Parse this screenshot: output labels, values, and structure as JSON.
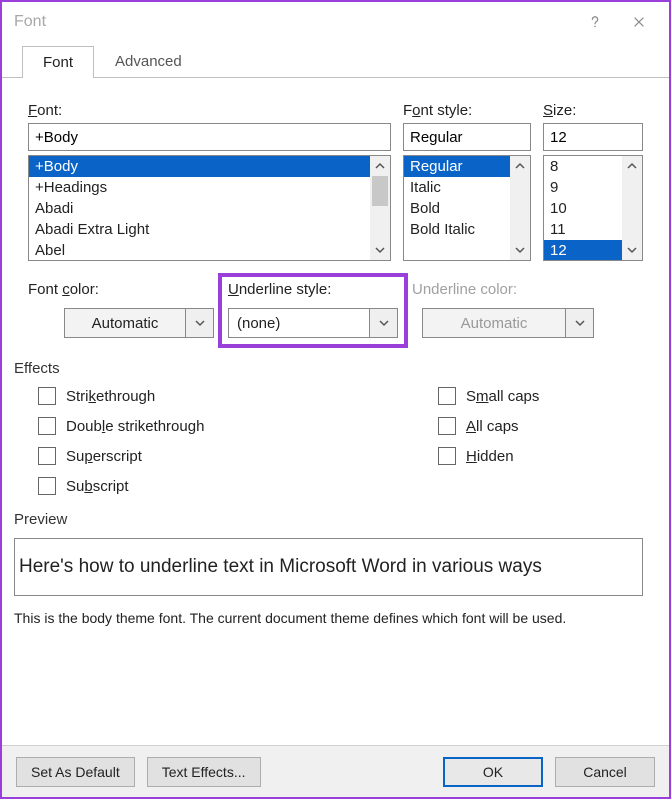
{
  "window": {
    "title": "Font"
  },
  "tabs": {
    "font": "Font",
    "advanced": "Advanced"
  },
  "labels": {
    "font": "Font:",
    "fontStyle": "Font style:",
    "size": "Size:",
    "fontColor": "Font color:",
    "underlineStyle": "Underline style:",
    "underlineColor": "Underline color:",
    "effects": "Effects",
    "preview": "Preview"
  },
  "accel": {
    "font": "F",
    "style": "o",
    "size": "S",
    "fontColor": "c",
    "underlineStyle": "U",
    "underlineColor": "I"
  },
  "fontField": {
    "value": "+Body"
  },
  "fontList": [
    "+Body",
    "+Headings",
    "Abadi",
    "Abadi Extra Light",
    "Abel"
  ],
  "fontSelected": 0,
  "styleField": {
    "value": "Regular"
  },
  "styleList": [
    "Regular",
    "Italic",
    "Bold",
    "Bold Italic"
  ],
  "styleSelected": 0,
  "sizeField": {
    "value": "12"
  },
  "sizeList": [
    "8",
    "9",
    "10",
    "11",
    "12"
  ],
  "sizeSelected": 4,
  "fontColor": {
    "value": "Automatic"
  },
  "underlineStyle": {
    "value": "(none)"
  },
  "underlineColor": {
    "value": "Automatic"
  },
  "effectsList": {
    "col1": [
      {
        "label": "Strikethrough",
        "ak": "k"
      },
      {
        "label": "Double strikethrough",
        "ak": "l"
      },
      {
        "label": "Superscript",
        "ak": "p"
      },
      {
        "label": "Subscript",
        "ak": "b"
      }
    ],
    "col2": [
      {
        "label": "Small caps",
        "ak": "m"
      },
      {
        "label": "All caps",
        "ak": "A"
      },
      {
        "label": "Hidden",
        "ak": "H"
      }
    ]
  },
  "previewText": "Here's how to underline text in Microsoft Word in various ways",
  "previewDesc": "This is the body theme font. The current document theme defines which font will be used.",
  "buttons": {
    "setDefault": "Set As Default",
    "textEffects": "Text Effects...",
    "ok": "OK",
    "cancel": "Cancel"
  }
}
